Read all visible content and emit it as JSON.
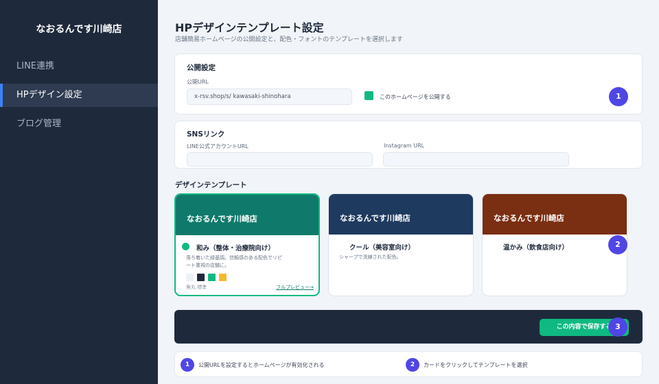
{
  "sidebar": {
    "brand": "なおるんです川崎店",
    "items": [
      {
        "label": "LINE連携",
        "active": false
      },
      {
        "label": "HPデザイン設定",
        "active": true
      },
      {
        "label": "ブログ管理",
        "active": false
      }
    ]
  },
  "header": {
    "title": "HPデザインテンプレート設定",
    "subtitle": "店舗簡易ホームページの公開設定と、配色・フォントのテンプレートを選択します"
  },
  "publish": {
    "title": "公開設定",
    "url_label": "公開URL",
    "url_value": "x-rsv.shop/s/ kawasaki-shinohara",
    "checkbox_label": "このホームページを公開する",
    "checked": true,
    "badge": "1"
  },
  "sns": {
    "title": "SNSリンク",
    "line_label": "LINE公式アカウントURL",
    "line_value": "",
    "instagram_label": "Instagram URL",
    "instagram_value": ""
  },
  "templates": {
    "title": "デザインテンプレート",
    "badge": "2",
    "items": [
      {
        "header": "なおるんです川崎店",
        "color": "#0f7a6b",
        "name": "和み（整体・治療院向け）",
        "desc": "落ち着いた緑基調。信頼感のある配色でリピート重視の店舗に。",
        "swatches": [
          "#eef1f6",
          "#1e2a3c",
          "#10b981",
          "#f5b82e"
        ],
        "meta": "角丸 標準",
        "link": "フルプレビュー→",
        "selected": true
      },
      {
        "header": "なおるんです川崎店",
        "color": "#1e3a5f",
        "name": "クール（美容室向け）",
        "desc": "シャープで洗練された配色。",
        "selected": false
      },
      {
        "header": "なおるんです川崎店",
        "color": "#7a2e12",
        "name": "温かみ（飲食店向け）",
        "desc": "",
        "selected": false
      }
    ]
  },
  "save": {
    "label": "この内容で保存する",
    "badge": "3"
  },
  "hints": [
    {
      "num": "1",
      "text": "公開URLを設定するとホームページが有効化される"
    },
    {
      "num": "2",
      "text": "カードをクリックしてテンプレートを選択"
    }
  ],
  "colors": {
    "sidebar": "#1e2a3c",
    "accent": "#10b981",
    "badge": "#4f46e5"
  }
}
